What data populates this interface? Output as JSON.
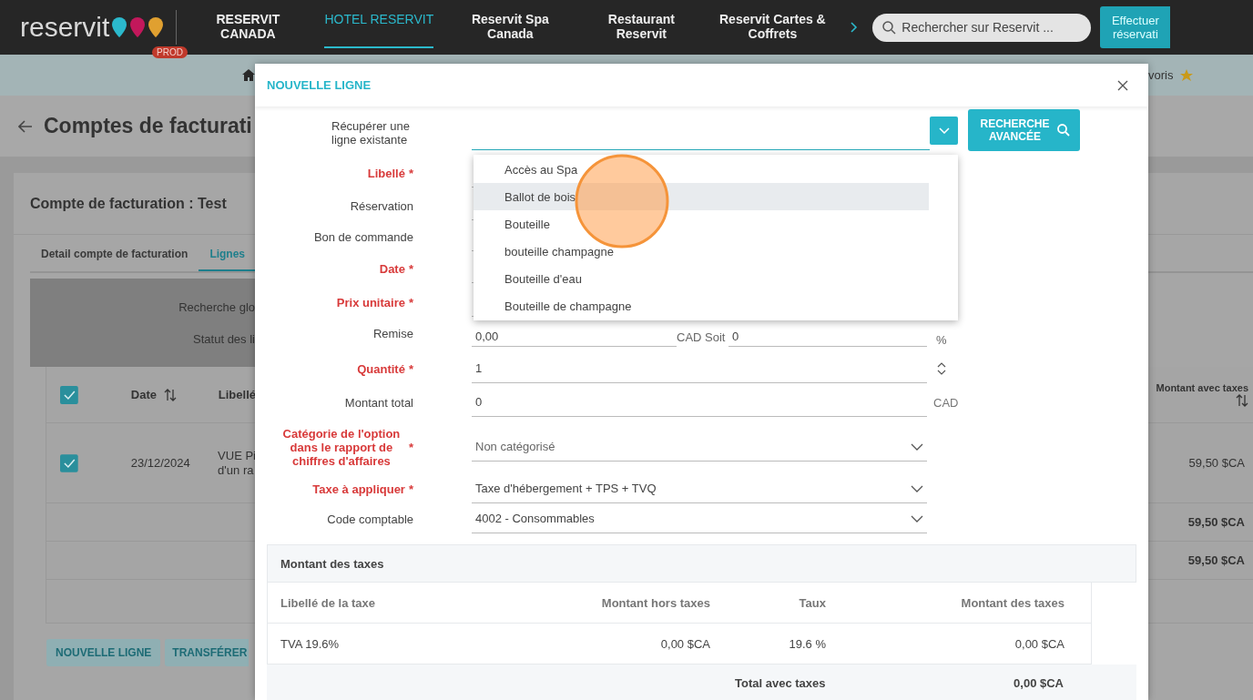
{
  "nav": {
    "logo": "reservit",
    "env_badge": "PROD",
    "items": [
      {
        "label": "RESERVIT CANADA",
        "selected": false
      },
      {
        "label": "HOTEL RESERVIT",
        "selected": true
      },
      {
        "label": "Reservit Spa Canada",
        "selected": false
      },
      {
        "label": "Restaurant Reservit",
        "selected": false
      },
      {
        "label": "Reservit Cartes & Coffrets",
        "selected": false
      }
    ],
    "search": {
      "placeholder": "Rechercher sur Reservit ..."
    },
    "action_button": "Effectuer réservati"
  },
  "breadcrumb": {
    "favorites": "voris"
  },
  "page": {
    "title": "Comptes de facturati",
    "card_title": "Compte de facturation : Test",
    "tabs": [
      {
        "label": "Detail compte de facturation",
        "selected": false
      },
      {
        "label": "Lignes",
        "selected": true
      }
    ],
    "filters": [
      "Recherche glo",
      "Statut des li"
    ],
    "table": {
      "columns": [
        "Date",
        "Libellé",
        "Montant avec taxes"
      ],
      "header_checked": true,
      "rows": [
        {
          "checked": true,
          "date": "23/12/2024",
          "label": [
            "VUE Pi",
            "d'un ra"
          ],
          "amount": "59,50 $CA"
        }
      ],
      "totals": [
        "59,50 $CA",
        "59,50 $CA"
      ]
    },
    "buttons": [
      "NOUVELLE LIGNE",
      "TRANSFÉRER"
    ]
  },
  "modal": {
    "title": "NOUVELLE LIGNE",
    "fields": [
      {
        "kind": "combo",
        "label": "Récupérer une ligne existante",
        "required": false
      },
      {
        "kind": "text",
        "label": "Libellé",
        "required": true,
        "mark": "*"
      },
      {
        "kind": "text",
        "label": "Réservation",
        "required": false
      },
      {
        "kind": "text",
        "label": "Bon de commande",
        "required": false
      },
      {
        "kind": "text",
        "label": "Date",
        "required": true,
        "mark": "*"
      },
      {
        "kind": "text",
        "label": "Prix unitaire",
        "required": true,
        "mark": "*"
      },
      {
        "kind": "remise",
        "label": "Remise",
        "required": false,
        "value": "0,00",
        "unit": "CAD Soit",
        "value2": "0",
        "unit2": "%"
      },
      {
        "kind": "number",
        "label": "Quantité",
        "required": true,
        "mark": "*",
        "value": "1"
      },
      {
        "kind": "amount",
        "label": "Montant total",
        "required": false,
        "value": "0",
        "unit": "CAD"
      },
      {
        "kind": "select",
        "label": "Catégorie de l'option dans le rapport de chiffres d'affaires",
        "required": true,
        "mark": "*",
        "value": "Non catégorisé"
      },
      {
        "kind": "select",
        "label": "Taxe à appliquer",
        "required": true,
        "mark": "*",
        "value": "Taxe d'hébergement + TPS + TVQ"
      },
      {
        "kind": "select",
        "label": "Code comptable",
        "required": false,
        "value": "4002 - Consommables"
      }
    ],
    "search_button": "RECHERCHE AVANCÉE",
    "dropdown": [
      {
        "label": "Accès au Spa",
        "selected": false
      },
      {
        "label": "Ballot de bois",
        "selected": true
      },
      {
        "label": "Bouteille",
        "selected": false
      },
      {
        "label": "bouteille champagne",
        "selected": false
      },
      {
        "label": "Bouteille d'eau",
        "selected": false
      },
      {
        "label": "Bouteille de champagne",
        "selected": false
      }
    ],
    "taxes": {
      "title": "Montant des taxes",
      "columns": [
        "Libellé de la taxe",
        "Montant hors taxes",
        "Taux",
        "Montant des taxes"
      ],
      "rows": [
        [
          "TVA 19.6%",
          "0,00 $CA",
          "19.6 %",
          "0,00 $CA"
        ]
      ],
      "total_label": "Total avec taxes",
      "total": "0,00 $CA"
    }
  }
}
